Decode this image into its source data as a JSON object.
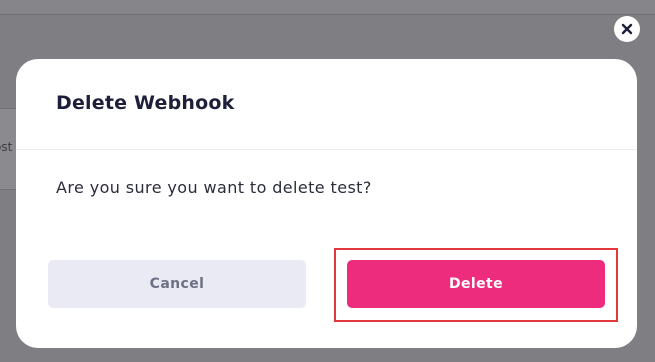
{
  "background": {
    "partial_text": "ost"
  },
  "dialog": {
    "title": "Delete Webhook",
    "message": "Are you sure you want to delete test?",
    "cancel_label": "Cancel",
    "delete_label": "Delete",
    "close_icon": "close-icon"
  },
  "colors": {
    "overlay": "#7e7e83",
    "delete_button": "#ee2c7e",
    "cancel_button": "#e9eaf3",
    "highlight_border": "#e5383e"
  }
}
